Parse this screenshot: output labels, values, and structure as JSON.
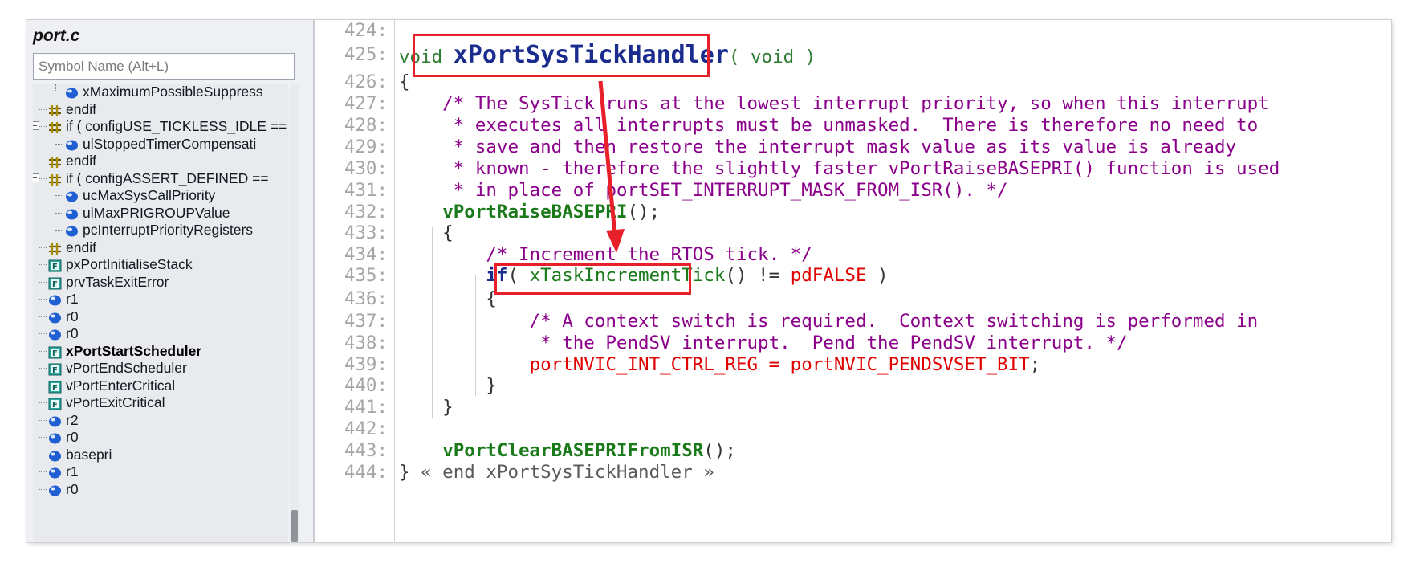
{
  "sidebar": {
    "file_title": "port.c",
    "search_placeholder": "Symbol Name (Alt+L)",
    "items": [
      {
        "label": "xMaximumPossibleSuppress",
        "icon": "variable-icon",
        "depth": 2
      },
      {
        "label": "endif",
        "icon": "preprocessor-icon",
        "depth": 1
      },
      {
        "label": "if ( configUSE_TICKLESS_IDLE ==",
        "icon": "preprocessor-icon",
        "depth": 1,
        "expander": "−"
      },
      {
        "label": "ulStoppedTimerCompensati",
        "icon": "variable-icon",
        "depth": 2
      },
      {
        "label": "endif",
        "icon": "preprocessor-icon",
        "depth": 1
      },
      {
        "label": "if ( configASSERT_DEFINED ==",
        "icon": "preprocessor-icon",
        "depth": 1,
        "expander": "−"
      },
      {
        "label": "ucMaxSysCallPriority",
        "icon": "variable-icon",
        "depth": 2
      },
      {
        "label": "ulMaxPRIGROUPValue",
        "icon": "variable-icon",
        "depth": 2
      },
      {
        "label": "pcInterruptPriorityRegisters",
        "icon": "variable-icon",
        "depth": 2
      },
      {
        "label": "endif",
        "icon": "preprocessor-icon",
        "depth": 1
      },
      {
        "label": "pxPortInitialiseStack",
        "icon": "function-icon",
        "depth": 1
      },
      {
        "label": "prvTaskExitError",
        "icon": "function-icon",
        "depth": 1
      },
      {
        "label": "r1",
        "icon": "variable-icon",
        "depth": 1
      },
      {
        "label": "r0",
        "icon": "variable-icon",
        "depth": 1
      },
      {
        "label": "r0",
        "icon": "variable-icon",
        "depth": 1
      },
      {
        "label": "xPortStartScheduler",
        "icon": "function-icon",
        "depth": 1,
        "bold": true
      },
      {
        "label": "vPortEndScheduler",
        "icon": "function-icon",
        "depth": 1
      },
      {
        "label": "vPortEnterCritical",
        "icon": "function-icon",
        "depth": 1
      },
      {
        "label": "vPortExitCritical",
        "icon": "function-icon",
        "depth": 1
      },
      {
        "label": "r2",
        "icon": "variable-icon",
        "depth": 1
      },
      {
        "label": "r0",
        "icon": "variable-icon",
        "depth": 1
      },
      {
        "label": "basepri",
        "icon": "variable-icon",
        "depth": 1
      },
      {
        "label": "r1",
        "icon": "variable-icon",
        "depth": 1
      },
      {
        "label": "r0",
        "icon": "variable-icon",
        "depth": 1
      }
    ]
  },
  "editor": {
    "lines": [
      {
        "n": "424:",
        "tokens": []
      },
      {
        "n": "425:",
        "tokens": [
          {
            "c": "kw",
            "t": "void "
          },
          {
            "c": "fn-def",
            "t": "xPortSysTickHandler"
          },
          {
            "c": "kw",
            "t": "( void )"
          }
        ]
      },
      {
        "n": "426:",
        "tokens": [
          {
            "c": "plain",
            "t": "{"
          }
        ]
      },
      {
        "n": "427:",
        "tokens": [
          {
            "c": "cm",
            "t": "    /* The SysTick runs at the lowest interrupt priority, so when this interrupt"
          }
        ]
      },
      {
        "n": "428:",
        "tokens": [
          {
            "c": "cm",
            "t": "     * executes all interrupts must be unmasked.  There is therefore no need to"
          }
        ]
      },
      {
        "n": "429:",
        "tokens": [
          {
            "c": "cm",
            "t": "     * save and then restore the interrupt mask value as its value is already"
          }
        ]
      },
      {
        "n": "430:",
        "tokens": [
          {
            "c": "cm",
            "t": "     * known - therefore the slightly faster vPortRaiseBASEPRI() function is used"
          }
        ]
      },
      {
        "n": "431:",
        "tokens": [
          {
            "c": "cm",
            "t": "     * in place of portSET_INTERRUPT_MASK_FROM_ISR(). */"
          }
        ]
      },
      {
        "n": "432:",
        "tokens": [
          {
            "c": "plain",
            "t": "    "
          },
          {
            "c": "fn-call",
            "t": "vPortRaiseBASEPRI"
          },
          {
            "c": "plain",
            "t": "();"
          }
        ]
      },
      {
        "n": "433:",
        "tokens": [
          {
            "c": "plain",
            "t": "    {"
          }
        ]
      },
      {
        "n": "434:",
        "tokens": [
          {
            "c": "cm",
            "t": "        /* Increment the RTOS tick. */"
          }
        ]
      },
      {
        "n": "435:",
        "tokens": [
          {
            "c": "plain",
            "t": "        "
          },
          {
            "c": "kwb",
            "t": "if"
          },
          {
            "c": "plain",
            "t": "( "
          },
          {
            "c": "fn-call2",
            "t": "xTaskIncrementTick"
          },
          {
            "c": "plain",
            "t": "() != "
          },
          {
            "c": "macro",
            "t": "pdFALSE"
          },
          {
            "c": "plain",
            "t": " )"
          }
        ]
      },
      {
        "n": "436:",
        "tokens": [
          {
            "c": "plain",
            "t": "        {"
          }
        ]
      },
      {
        "n": "437:",
        "tokens": [
          {
            "c": "cm",
            "t": "            /* A context switch is required.  Context switching is performed in"
          }
        ]
      },
      {
        "n": "438:",
        "tokens": [
          {
            "c": "cm",
            "t": "             * the PendSV interrupt.  Pend the PendSV interrupt. */"
          }
        ]
      },
      {
        "n": "439:",
        "tokens": [
          {
            "c": "plain",
            "t": "            "
          },
          {
            "c": "macro",
            "t": "portNVIC_INT_CTRL_REG = portNVIC_PENDSVSET_BIT"
          },
          {
            "c": "plain",
            "t": ";"
          }
        ]
      },
      {
        "n": "440:",
        "tokens": [
          {
            "c": "plain",
            "t": "        }"
          }
        ]
      },
      {
        "n": "441:",
        "tokens": [
          {
            "c": "plain",
            "t": "    }"
          }
        ]
      },
      {
        "n": "442:",
        "tokens": []
      },
      {
        "n": "443:",
        "tokens": [
          {
            "c": "plain",
            "t": "    "
          },
          {
            "c": "fn-call",
            "t": "vPortClearBASEPRIFromISR"
          },
          {
            "c": "plain",
            "t": "();"
          }
        ]
      },
      {
        "n": "444:",
        "tokens": [
          {
            "c": "plain",
            "t": "} "
          },
          {
            "c": "end-note",
            "t": "« end xPortSysTickHandler »"
          }
        ]
      }
    ]
  },
  "annotations": {
    "highlight_color": "#e8202a",
    "highlights": [
      "xPortSysTickHandler",
      "xTaskIncrementTick"
    ]
  }
}
